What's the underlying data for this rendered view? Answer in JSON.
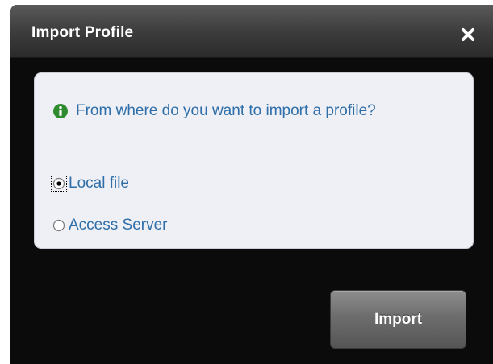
{
  "dialog": {
    "title": "Import Profile",
    "close_icon": "close-x-icon"
  },
  "prompt": {
    "icon": "info-icon",
    "icon_color": "#2e8b2e",
    "text": "From where do you want to import a profile?"
  },
  "options": [
    {
      "label": "Local file",
      "selected": true
    },
    {
      "label": "Access Server",
      "selected": false
    }
  ],
  "actions": {
    "import_label": "Import"
  },
  "colors": {
    "dialog_bg": "#0b0b0b",
    "panel_bg": "#eef0f5",
    "text_blue": "#2f6ea8"
  }
}
